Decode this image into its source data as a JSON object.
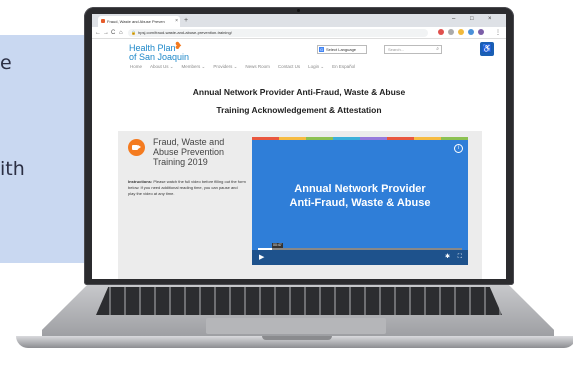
{
  "backdrop": {
    "fragment_top": "e",
    "fragment_mid": "ith"
  },
  "browser": {
    "tab_title": "Fraud, Waste and Abuse Preven",
    "new_tab": "+",
    "window_controls": [
      "–",
      "□",
      "×"
    ],
    "url": "hpsj.com/fraud-waste-and-abuse-prevention-training/",
    "nav": {
      "back": "←",
      "forward": "→",
      "reload": "C",
      "home": "⌂"
    }
  },
  "site": {
    "logo_line1": "Health Plan",
    "logo_line2": "of San Joaquin",
    "select_language": "Select Language",
    "search_placeholder": "Search...",
    "nav_items": [
      "Home",
      "About Us ⌄",
      "Members ⌄",
      "Providers ⌄",
      "News Room",
      "Contact Us",
      "Login ⌄",
      "En Español"
    ]
  },
  "page": {
    "title_line1": "Annual Network Provider Anti-Fraud, Waste & Abuse",
    "title_line2": "Training Acknowledgement & Attestation",
    "course_title_l1": "Fraud, Waste and",
    "course_title_l2": "Abuse Prevention",
    "course_title_l3": "Training 2019",
    "instructions_label": "Instructions:",
    "instructions_text": "Please watch the full video before filling out the form below. If you need additional reading time, you can pause and play the video at any time."
  },
  "video": {
    "title_line1": "Annual Network Provider",
    "title_line2": "Anti-Fraud, Waste & Abuse",
    "time": "00:47",
    "progress": 0.07,
    "strip_colors": [
      "#e9573f",
      "#f6bb42",
      "#8cc152",
      "#3bafda",
      "#967adc",
      "#e9573f",
      "#f6bb42",
      "#8cc152"
    ]
  },
  "icons": {
    "info": "i",
    "play": "▶",
    "settings": "✱",
    "fullscreen": "⛶",
    "search": "⌕",
    "accessibility": "♿"
  }
}
